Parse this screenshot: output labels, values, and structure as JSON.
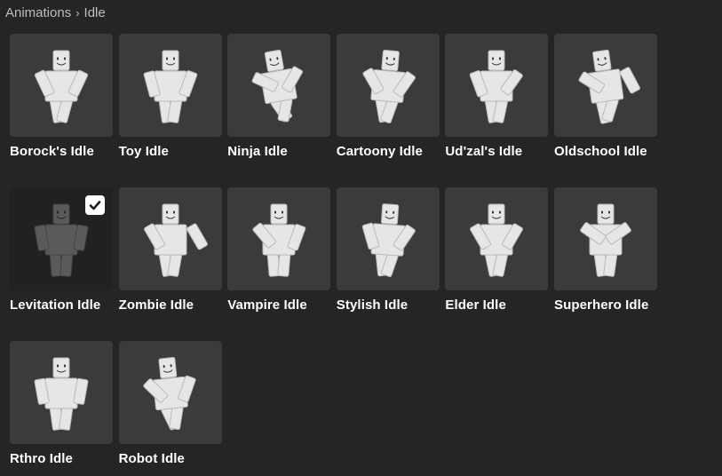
{
  "breadcrumb": {
    "parent": "Animations",
    "current": "Idle"
  },
  "items": [
    {
      "name": "Borock's Idle"
    },
    {
      "name": "Toy Idle"
    },
    {
      "name": "Ninja Idle"
    },
    {
      "name": "Cartoony Idle"
    },
    {
      "name": "Ud'zal's Idle"
    },
    {
      "name": "Oldschool Idle"
    },
    {
      "name": "Levitation Idle",
      "selected": true
    },
    {
      "name": "Zombie Idle"
    },
    {
      "name": "Vampire Idle"
    },
    {
      "name": "Stylish Idle"
    },
    {
      "name": "Elder Idle"
    },
    {
      "name": "Superhero Idle"
    },
    {
      "name": "Rthro Idle"
    },
    {
      "name": "Robot Idle"
    }
  ],
  "colors": {
    "background": "#232527",
    "tile": "#393b3d",
    "tile_selected": "#1f2123",
    "avatar": "#e6e6e6",
    "avatar_selected": "#5a5a5a"
  }
}
